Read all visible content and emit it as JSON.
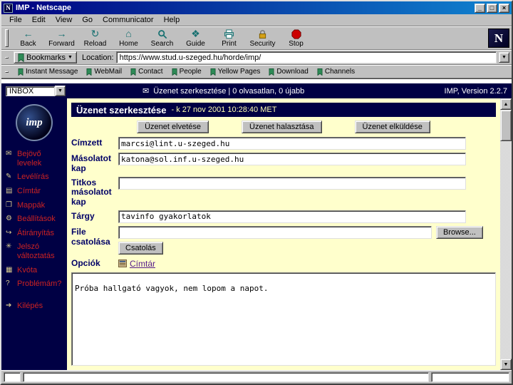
{
  "window": {
    "title": "IMP - Netscape",
    "minimize": "_",
    "maximize": "□",
    "close": "×",
    "logo_letter": "N"
  },
  "menu": {
    "items": [
      "File",
      "Edit",
      "View",
      "Go",
      "Communicator",
      "Help"
    ]
  },
  "toolbar": {
    "buttons": [
      {
        "label": "Back"
      },
      {
        "label": "Forward"
      },
      {
        "label": "Reload"
      },
      {
        "label": "Home"
      },
      {
        "label": "Search"
      },
      {
        "label": "Guide"
      },
      {
        "label": "Print"
      },
      {
        "label": "Security"
      },
      {
        "label": "Stop"
      }
    ],
    "back_glyph": "←",
    "forward_glyph": "→",
    "reload_glyph": "↻",
    "home_glyph": "⌂",
    "guide_glyph": "❖"
  },
  "location_bar": {
    "bookmarks_label": "Bookmarks",
    "location_label": "Location:",
    "url": "https://www.stud.u-szeged.hu/horde/imp/"
  },
  "personal_toolbar": {
    "links": [
      "Instant Message",
      "WebMail",
      "Contact",
      "People",
      "Yellow Pages",
      "Download",
      "Channels"
    ]
  },
  "imp": {
    "topbar": {
      "mailbox": "INBOX",
      "status": "Üzenet szerkesztése  |  0 olvasatlan, 0 újabb",
      "status_glyph": "✉",
      "version": "IMP, Version 2.2.7"
    },
    "sidebar": {
      "logo": "imp",
      "items": [
        {
          "label": "Bejövő levelek",
          "glyph": "✉"
        },
        {
          "label": "Levélírás",
          "glyph": "✎"
        },
        {
          "label": "Címtár",
          "glyph": "▤"
        },
        {
          "label": "Mappák",
          "glyph": "❒"
        },
        {
          "label": "Beállítások",
          "glyph": "⚙"
        },
        {
          "label": "Átirányítás",
          "glyph": "↪"
        },
        {
          "label": "Jelszó változtatás",
          "glyph": "✳"
        },
        {
          "label": "Kvóta",
          "glyph": "▦"
        },
        {
          "label": "Problémám?",
          "glyph": "?"
        },
        {
          "label": "Kilépés",
          "glyph": "➔"
        }
      ]
    },
    "compose": {
      "title": "Üzenet szerkesztése",
      "date": "- k 27 nov 2001 10:28:40 MET",
      "actions": [
        "Üzenet elvetése",
        "Üzenet halasztása",
        "Üzenet elküldése"
      ],
      "fields": {
        "to": {
          "label": "Címzett",
          "value": "marcsi@lint.u-szeged.hu"
        },
        "cc": {
          "label": "Másolatot kap",
          "value": "katona@sol.inf.u-szeged.hu"
        },
        "bcc": {
          "label": "Titkos másolatot kap",
          "value": ""
        },
        "subject": {
          "label": "Tárgy",
          "value": "tavinfo gyakorlatok"
        },
        "attachment": {
          "label": "File csatolása",
          "value": "",
          "browse_label": "Browse...",
          "attach_label": "Csatolás"
        },
        "options": {
          "label": "Opciók",
          "link_label": "Címtár"
        }
      },
      "message": "\nPróba hallgató vagyok, nem lopom a napot."
    }
  },
  "colors": {
    "navy": "#000044",
    "page_bg": "#ffffcc",
    "sidebar_link": "#cc2222",
    "titlebar_gradient_start": "#000080",
    "titlebar_gradient_end": "#1084d0"
  }
}
